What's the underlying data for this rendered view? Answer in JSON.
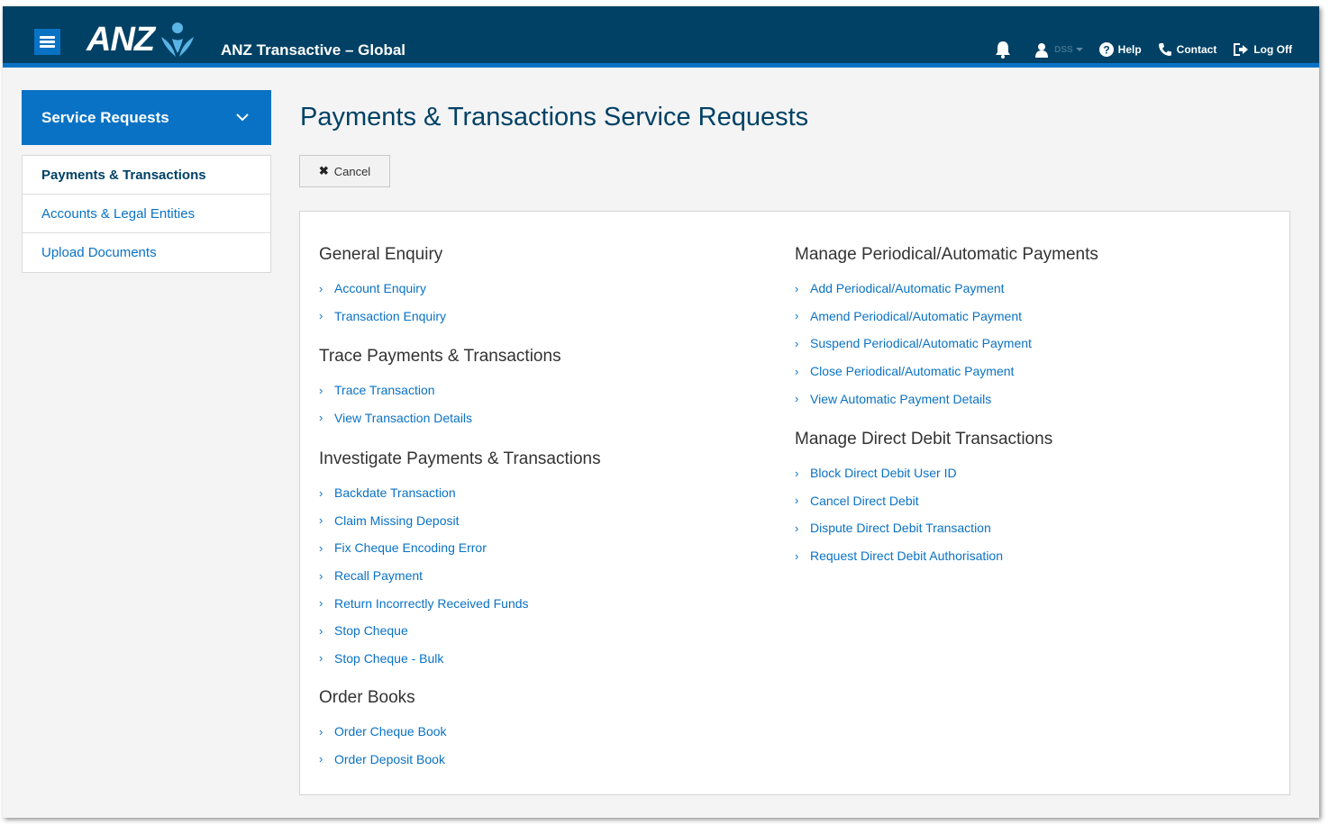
{
  "header": {
    "logo_text": "ANZ",
    "app_title": "ANZ Transactive – Global",
    "user_name": "DSS",
    "help_label": "Help",
    "contact_label": "Contact",
    "logoff_label": "Log Off"
  },
  "sidebar": {
    "heading": "Service Requests",
    "items": [
      {
        "label": "Payments & Transactions"
      },
      {
        "label": "Accounts & Legal Entities"
      },
      {
        "label": "Upload Documents"
      }
    ]
  },
  "main": {
    "title": "Payments & Transactions Service Requests",
    "cancel_label": "Cancel",
    "left_groups": [
      {
        "title": "General Enquiry",
        "links": [
          "Account Enquiry",
          "Transaction Enquiry"
        ]
      },
      {
        "title": "Trace Payments & Transactions",
        "links": [
          "Trace Transaction",
          "View Transaction Details"
        ]
      },
      {
        "title": "Investigate Payments & Transactions",
        "links": [
          "Backdate Transaction",
          "Claim Missing Deposit",
          "Fix Cheque Encoding Error",
          "Recall Payment",
          "Return Incorrectly Received Funds",
          "Stop Cheque",
          "Stop Cheque - Bulk"
        ]
      },
      {
        "title": "Order Books",
        "links": [
          "Order Cheque Book",
          "Order Deposit Book"
        ]
      }
    ],
    "right_groups": [
      {
        "title": "Manage Periodical/Automatic Payments",
        "links": [
          "Add Periodical/Automatic Payment",
          "Amend Periodical/Automatic Payment",
          "Suspend Periodical/Automatic Payment",
          "Close Periodical/Automatic Payment",
          "View Automatic Payment Details"
        ]
      },
      {
        "title": "Manage Direct Debit Transactions",
        "links": [
          "Block Direct Debit User ID",
          "Cancel Direct Debit",
          "Dispute Direct Debit Transaction",
          "Request Direct Debit Authorisation"
        ]
      }
    ]
  },
  "colors": {
    "header_bg": "#004165",
    "accent": "#0a72c4",
    "page_bg": "#f4f4f4"
  }
}
